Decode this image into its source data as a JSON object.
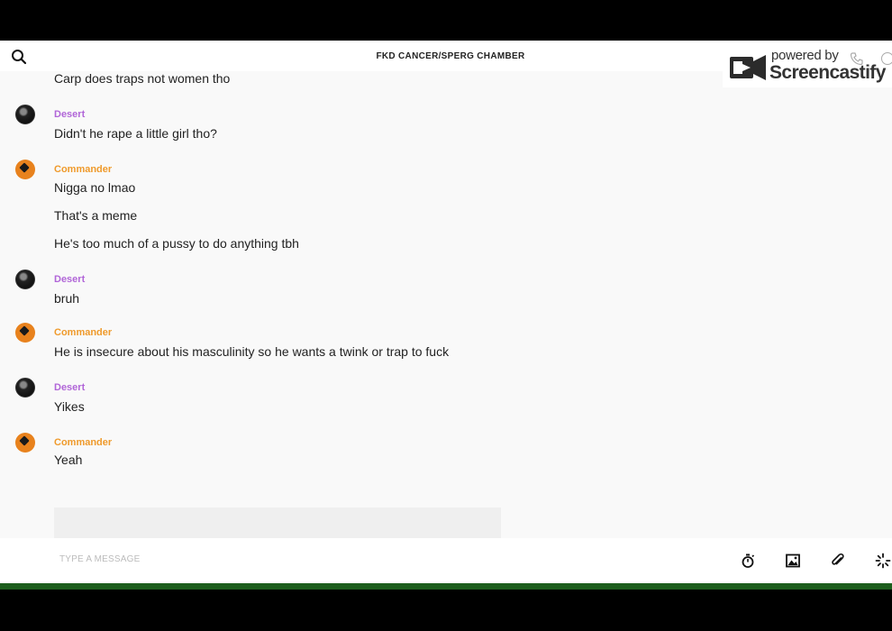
{
  "header": {
    "title": "FKD CANCER/SPERG CHAMBER"
  },
  "watermark": {
    "powered": "powered by",
    "brand": "Screencastify"
  },
  "messages": [
    {
      "text": "Carp does traps not women tho"
    },
    {
      "sender": "Desert",
      "text": "Didn't he rape a little girl tho?"
    },
    {
      "sender": "Commander",
      "text": "Nigga no lmao"
    },
    {
      "text": "That's a meme"
    },
    {
      "text": "He's too much of a pussy to do anything tbh"
    },
    {
      "sender": "Desert",
      "text": "bruh"
    },
    {
      "sender": "Commander",
      "text": "He is insecure about his masculinity so he wants a twink or trap to fuck"
    },
    {
      "sender": "Desert",
      "text": "Yikes"
    },
    {
      "sender": "Commander",
      "text": "Yeah"
    }
  ],
  "composer": {
    "placeholder": "TYPE A MESSAGE"
  },
  "icons": {
    "search": "search-icon",
    "timer": "stopwatch-icon",
    "image": "image-icon",
    "attach": "paperclip-icon",
    "loading": "spinner-icon"
  },
  "colors": {
    "desert": "#b166d8",
    "commander": "#ef9a2b",
    "bar": "#1d5e1d"
  }
}
